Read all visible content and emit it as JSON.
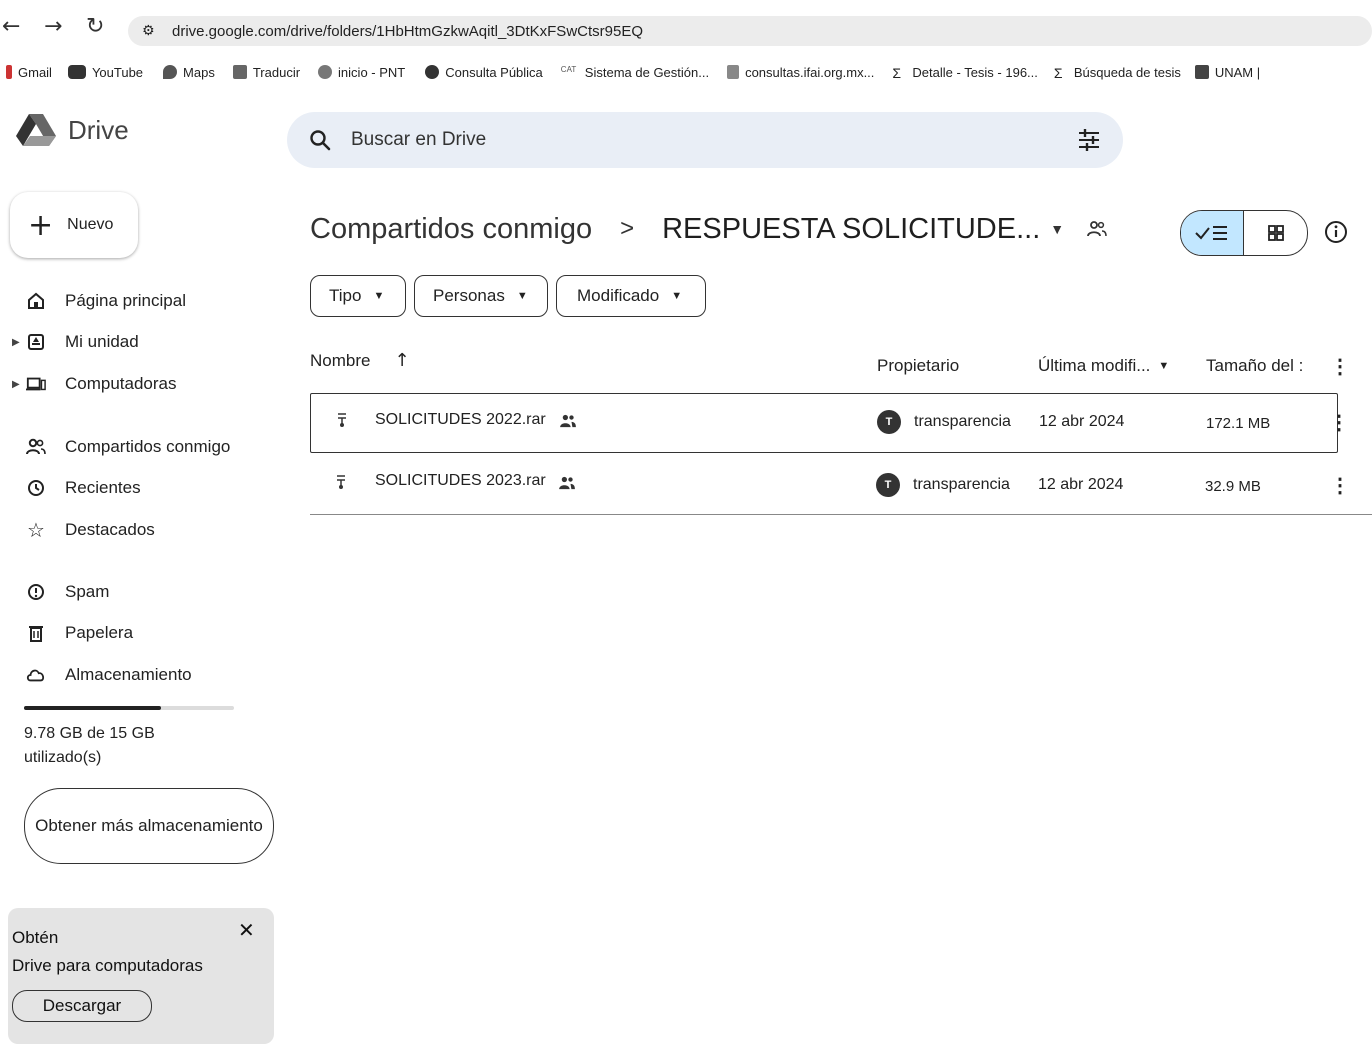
{
  "browser": {
    "url": "drive.google.com/drive/folders/1HbHtmGzkwAqitl_3DtKxFSwCtsr95EQ",
    "bookmarks": [
      {
        "label": "Gmail",
        "icon": "gmail-icon"
      },
      {
        "label": "YouTube",
        "icon": "youtube-icon"
      },
      {
        "label": "Maps",
        "icon": "maps-icon"
      },
      {
        "label": "Traducir",
        "icon": "translate-icon"
      },
      {
        "label": "inicio - PNT",
        "icon": "pnt-icon"
      },
      {
        "label": "Consulta Pública",
        "icon": "globe-icon"
      },
      {
        "label": "Sistema de Gestión...",
        "icon": "cat-icon"
      },
      {
        "label": "consultas.ifai.org.mx...",
        "icon": "ifai-icon"
      },
      {
        "label": "Detalle - Tesis - 196...",
        "icon": "sigma-icon"
      },
      {
        "label": "Búsqueda de tesis",
        "icon": "sigma-icon"
      },
      {
        "label": "UNAM |",
        "icon": "unam-icon"
      }
    ]
  },
  "app": {
    "name": "Drive",
    "search_placeholder": "Buscar en Drive"
  },
  "sidebar": {
    "new_label": "Nuevo",
    "items": [
      {
        "label": "Página principal"
      },
      {
        "label": "Mi unidad"
      },
      {
        "label": "Computadoras"
      },
      {
        "label": "Compartidos conmigo"
      },
      {
        "label": "Recientes"
      },
      {
        "label": "Destacados"
      },
      {
        "label": "Spam"
      },
      {
        "label": "Papelera"
      },
      {
        "label": "Almacenamiento"
      }
    ],
    "storage": {
      "used_fraction": 0.652,
      "text": "9.78 GB de 15 GB utilizado(s)"
    },
    "get_more_label": "Obtener más almacenamiento",
    "promo": {
      "title_line1": "Obtén",
      "title_line2": "Drive para computadoras",
      "download_label": "Descargar"
    }
  },
  "main": {
    "breadcrumb": {
      "parent": "Compartidos conmigo",
      "separator": ">",
      "current": "RESPUESTA SOLICITUDE..."
    },
    "filters": [
      "Tipo",
      "Personas",
      "Modificado"
    ],
    "columns": {
      "name": "Nombre",
      "owner": "Propietario",
      "modified": "Última modifi...",
      "size": "Tamaño del :"
    },
    "rows": [
      {
        "name": "SOLICITUDES 2022.rar",
        "owner": "transparencia",
        "modified": "12 abr 2024",
        "size": "172.1 MB",
        "selected": true
      },
      {
        "name": "SOLICITUDES 2023.rar",
        "owner": "transparencia",
        "modified": "12 abr 2024",
        "size": "32.9 MB",
        "selected": false
      }
    ]
  }
}
